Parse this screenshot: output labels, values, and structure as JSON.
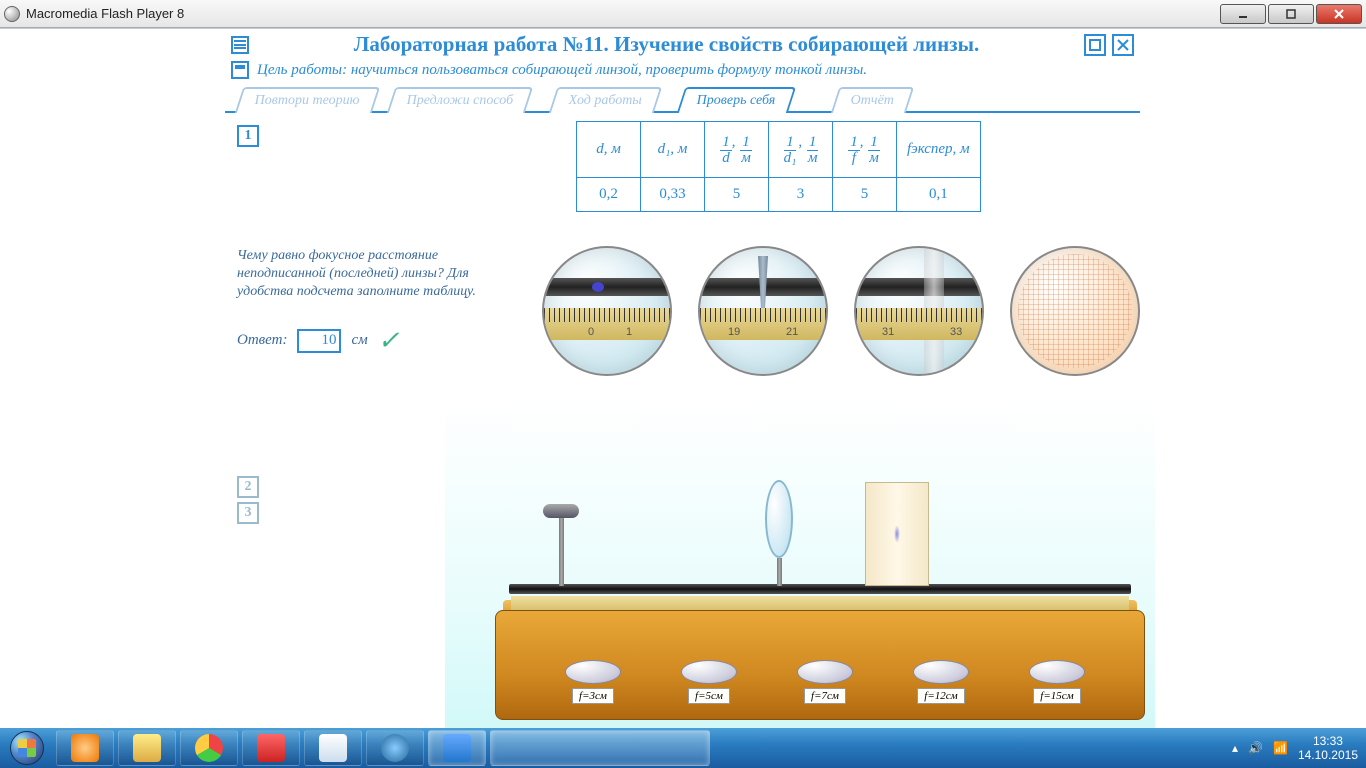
{
  "window": {
    "title": "Macromedia Flash Player 8"
  },
  "header": {
    "title": "Лабораторная работа №11.  Изучение свойств собирающей линзы.",
    "goal": "Цель работы: научиться пользоваться собирающей линзой, проверить формулу тонкой линзы."
  },
  "tabs": {
    "t1": "Повтори теорию",
    "t2": "Предложи способ",
    "t3": "Ход работы",
    "t4": "Проверь себя",
    "t5": "Отчёт"
  },
  "question": {
    "num1": "1",
    "num2": "2",
    "num3": "3",
    "text": "Чему равно фокусное расстояние неподписанной (последней) линзы? Для удобства подсчета заполните таблицу.",
    "answerLabel": "Ответ:",
    "answerValue": "10",
    "answerUnit": "см"
  },
  "table": {
    "h1": "d, м",
    "h2": "d₁, м",
    "h6": "fэкспер, м",
    "r1c1": "0,2",
    "r1c2": "0,33",
    "r1c3": "5",
    "r1c4": "3",
    "r1c5": "5",
    "r1c6": "0,1"
  },
  "magnifiers": {
    "m1a": "0",
    "m1b": "1",
    "m2a": "19",
    "m2b": "21",
    "m3a": "31",
    "m3b": "33"
  },
  "lenses": {
    "l1": "f=3см",
    "l2": "f=5см",
    "l3": "f=7см",
    "l4": "f=12см",
    "l5": "f=15см"
  },
  "tray": {
    "time": "13:33",
    "date": "14.10.2015"
  }
}
